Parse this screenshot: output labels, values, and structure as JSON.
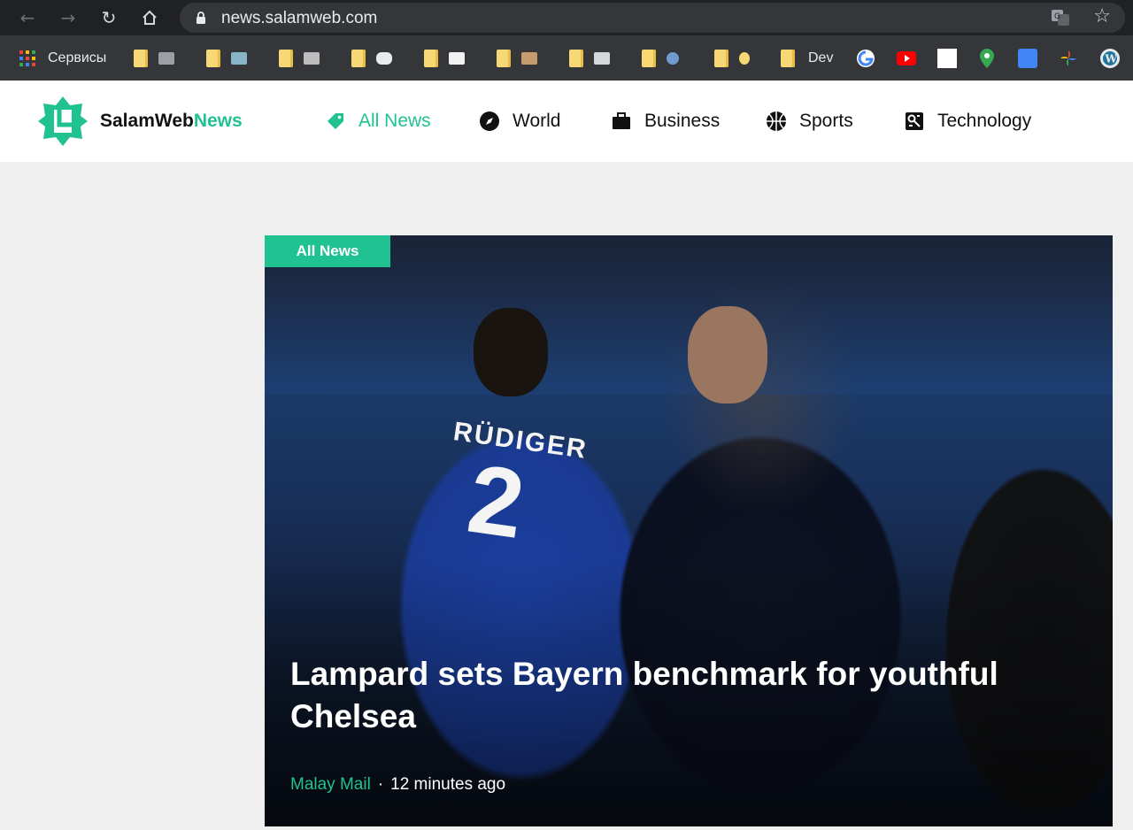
{
  "browser": {
    "url": "news.salamweb.com",
    "bookmarks": {
      "apps_label": "Сервисы",
      "dev_label": "Dev"
    }
  },
  "site": {
    "brand_main": "SalamWeb",
    "brand_accent": "News",
    "accent_color": "#21c292",
    "nav": [
      {
        "label": "All News",
        "icon": "tag-icon",
        "active": true
      },
      {
        "label": "World",
        "icon": "compass-icon"
      },
      {
        "label": "Business",
        "icon": "briefcase-icon"
      },
      {
        "label": "Sports",
        "icon": "basketball-icon"
      },
      {
        "label": "Technology",
        "icon": "technology-icon"
      }
    ]
  },
  "hero": {
    "tag": "All News",
    "headline": "Lampard sets Bayern benchmark for youthful Chelsea",
    "source": "Malay Mail",
    "separator": "·",
    "time": "12 minutes ago",
    "shirt_name": "RÜDIGER",
    "shirt_number": "2"
  }
}
